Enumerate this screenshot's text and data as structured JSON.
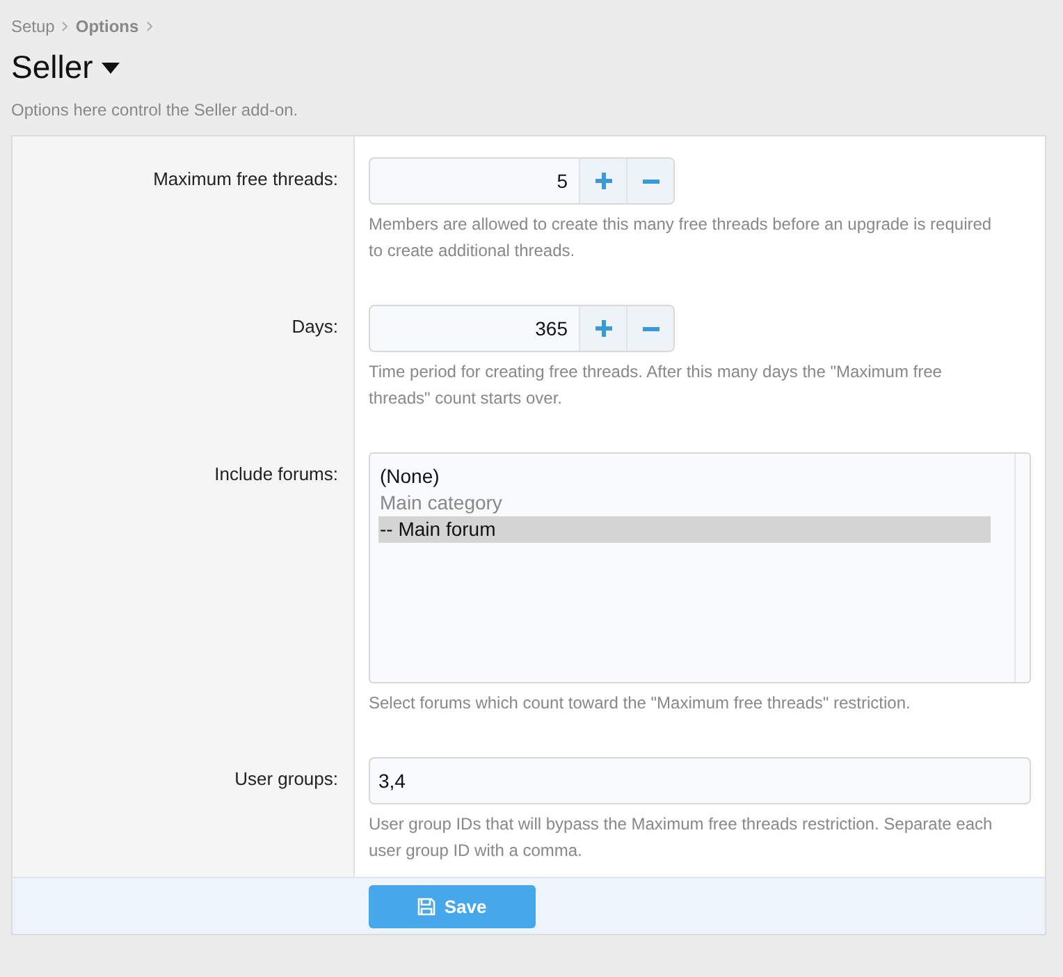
{
  "breadcrumb": [
    {
      "label": "Setup",
      "current": false
    },
    {
      "label": "Options",
      "current": true
    }
  ],
  "title": "Seller",
  "description": "Options here control the Seller add-on.",
  "options": [
    {
      "kind": "spinner",
      "label": "Maximum free threads:",
      "value": "5",
      "hint": "Members are allowed to create this many free threads before an upgrade is required to create additional threads."
    },
    {
      "kind": "spinner",
      "label": "Days:",
      "value": "365",
      "hint": "Time period for creating free threads. After this many days the \"Maximum free threads\" count starts over."
    },
    {
      "kind": "multiselect",
      "label": "Include forums:",
      "items": [
        {
          "label": "(None)",
          "selected": false,
          "disabled": false
        },
        {
          "label": "Main category",
          "selected": false,
          "disabled": true
        },
        {
          "label": "-- Main forum",
          "selected": true,
          "disabled": false
        }
      ],
      "hint": "Select forums which count toward the \"Maximum free threads\" restriction."
    },
    {
      "kind": "text",
      "label": "User groups:",
      "value": "3,4",
      "hint": "User group IDs that will bypass the Maximum free threads restriction. Separate each user group ID with a comma."
    }
  ],
  "save_button": "Save"
}
